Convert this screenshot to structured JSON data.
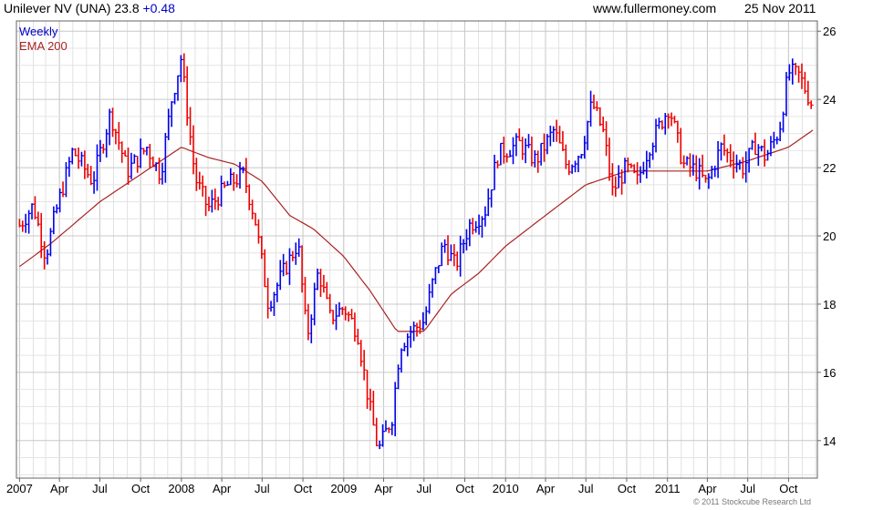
{
  "header": {
    "title": "Unilever NV (UNA) 23.8",
    "change": "+0.48",
    "site": "www.fullermoney.com",
    "date": "25 Nov 2011"
  },
  "legend": [
    {
      "label": "Weekly",
      "color": "#0000cc"
    },
    {
      "label": "EMA 200",
      "color": "#aa2222"
    }
  ],
  "footer": {
    "copyright": "© 2011 Stockcube Research Ltd"
  },
  "colors": {
    "up": "#0000ee",
    "down": "#ee0000",
    "ema": "#aa2222",
    "grid": "#c8c8c8"
  },
  "chart_data": {
    "type": "line",
    "subtype": "ohlc-bars",
    "series_type": "weekly price bars with EMA 200 overlay",
    "x_tick_labels": [
      "2007",
      "Apr",
      "Jul",
      "Oct",
      "2008",
      "Apr",
      "Jul",
      "Oct",
      "2009",
      "Apr",
      "Jul",
      "Oct",
      "2010",
      "Apr",
      "Jul",
      "Oct",
      "2011",
      "Apr",
      "Jul",
      "Oct"
    ],
    "x_tick_dates": [
      "2007-01",
      "2007-04",
      "2007-07",
      "2007-10",
      "2008-01",
      "2008-04",
      "2008-07",
      "2008-10",
      "2009-01",
      "2009-04",
      "2009-07",
      "2009-10",
      "2010-01",
      "2010-04",
      "2010-07",
      "2010-10",
      "2011-01",
      "2011-04",
      "2011-07",
      "2011-10"
    ],
    "x_start": "2006-12-25",
    "x_end": "2011-12-05",
    "y_ticks": [
      14,
      16,
      18,
      20,
      22,
      24,
      26
    ],
    "ylim": [
      12.9,
      26.3
    ],
    "y_axis_side": "right",
    "grid": true,
    "price_anchors": [
      {
        "date": "2007-01-01",
        "close": 20.3
      },
      {
        "date": "2007-02-01",
        "close": 20.9
      },
      {
        "date": "2007-03-01",
        "close": 19.4
      },
      {
        "date": "2007-03-20",
        "close": 20.5
      },
      {
        "date": "2007-05-01",
        "close": 22.5
      },
      {
        "date": "2007-06-15",
        "close": 21.6
      },
      {
        "date": "2007-07-25",
        "close": 23.6
      },
      {
        "date": "2007-09-01",
        "close": 21.9
      },
      {
        "date": "2007-10-15",
        "close": 22.6
      },
      {
        "date": "2007-11-15",
        "close": 21.8
      },
      {
        "date": "2007-12-10",
        "close": 24.0
      },
      {
        "date": "2007-12-31",
        "close": 25.2
      },
      {
        "date": "2008-02-01",
        "close": 21.7
      },
      {
        "date": "2008-03-01",
        "close": 20.8
      },
      {
        "date": "2008-04-15",
        "close": 21.5
      },
      {
        "date": "2008-05-20",
        "close": 21.8
      },
      {
        "date": "2008-06-15",
        "close": 20.5
      },
      {
        "date": "2008-07-15",
        "close": 18.0
      },
      {
        "date": "2008-08-20",
        "close": 19.0
      },
      {
        "date": "2008-09-20",
        "close": 19.8
      },
      {
        "date": "2008-10-10",
        "close": 17.0
      },
      {
        "date": "2008-11-05",
        "close": 19.0
      },
      {
        "date": "2008-12-01",
        "close": 17.6
      },
      {
        "date": "2009-01-01",
        "close": 17.9
      },
      {
        "date": "2009-02-01",
        "close": 17.2
      },
      {
        "date": "2009-02-28",
        "close": 15.0
      },
      {
        "date": "2009-03-20",
        "close": 13.7
      },
      {
        "date": "2009-04-20",
        "close": 14.7
      },
      {
        "date": "2009-05-08",
        "close": 16.8
      },
      {
        "date": "2009-06-01",
        "close": 17.2
      },
      {
        "date": "2009-07-01",
        "close": 17.5
      },
      {
        "date": "2009-07-20",
        "close": 18.6
      },
      {
        "date": "2009-08-15",
        "close": 19.8
      },
      {
        "date": "2009-09-10",
        "close": 19.1
      },
      {
        "date": "2009-10-10",
        "close": 20.3
      },
      {
        "date": "2009-11-15",
        "close": 20.7
      },
      {
        "date": "2009-12-15",
        "close": 22.4
      },
      {
        "date": "2010-02-01",
        "close": 22.7
      },
      {
        "date": "2010-03-10",
        "close": 22.2
      },
      {
        "date": "2010-04-20",
        "close": 23.1
      },
      {
        "date": "2010-05-20",
        "close": 22.0
      },
      {
        "date": "2010-06-20",
        "close": 22.5
      },
      {
        "date": "2010-07-15",
        "close": 23.9
      },
      {
        "date": "2010-08-10",
        "close": 23.0
      },
      {
        "date": "2010-08-30",
        "close": 21.3
      },
      {
        "date": "2010-09-30",
        "close": 22.0
      },
      {
        "date": "2010-10-25",
        "close": 21.6
      },
      {
        "date": "2010-11-20",
        "close": 22.6
      },
      {
        "date": "2011-01-05",
        "close": 23.8
      },
      {
        "date": "2011-02-05",
        "close": 22.1
      },
      {
        "date": "2011-03-10",
        "close": 21.9
      },
      {
        "date": "2011-03-30",
        "close": 21.5
      },
      {
        "date": "2011-05-01",
        "close": 22.6
      },
      {
        "date": "2011-06-01",
        "close": 22.2
      },
      {
        "date": "2011-06-20",
        "close": 22.0
      },
      {
        "date": "2011-07-20",
        "close": 22.7
      },
      {
        "date": "2011-08-10",
        "close": 22.3
      },
      {
        "date": "2011-09-10",
        "close": 23.1
      },
      {
        "date": "2011-10-01",
        "close": 24.8
      },
      {
        "date": "2011-10-25",
        "close": 24.7
      },
      {
        "date": "2011-11-25",
        "close": 23.8
      }
    ],
    "ema_anchors": [
      {
        "date": "2007-01-01",
        "value": 19.1
      },
      {
        "date": "2007-03-15",
        "value": 19.8
      },
      {
        "date": "2007-07-01",
        "value": 21.0
      },
      {
        "date": "2007-10-01",
        "value": 21.8
      },
      {
        "date": "2008-01-01",
        "value": 22.6
      },
      {
        "date": "2008-03-01",
        "value": 22.3
      },
      {
        "date": "2008-05-01",
        "value": 22.1
      },
      {
        "date": "2008-07-01",
        "value": 21.6
      },
      {
        "date": "2008-09-01",
        "value": 20.6
      },
      {
        "date": "2008-10-25",
        "value": 20.2
      },
      {
        "date": "2009-01-01",
        "value": 19.4
      },
      {
        "date": "2009-03-01",
        "value": 18.4
      },
      {
        "date": "2009-05-01",
        "value": 17.2
      },
      {
        "date": "2009-07-01",
        "value": 17.2
      },
      {
        "date": "2009-09-01",
        "value": 18.3
      },
      {
        "date": "2009-11-01",
        "value": 18.9
      },
      {
        "date": "2010-01-01",
        "value": 19.7
      },
      {
        "date": "2010-04-01",
        "value": 20.6
      },
      {
        "date": "2010-07-01",
        "value": 21.5
      },
      {
        "date": "2010-10-01",
        "value": 21.9
      },
      {
        "date": "2011-01-01",
        "value": 21.9
      },
      {
        "date": "2011-04-01",
        "value": 21.9
      },
      {
        "date": "2011-07-01",
        "value": 22.2
      },
      {
        "date": "2011-10-01",
        "value": 22.6
      },
      {
        "date": "2011-11-25",
        "value": 23.1
      }
    ]
  }
}
